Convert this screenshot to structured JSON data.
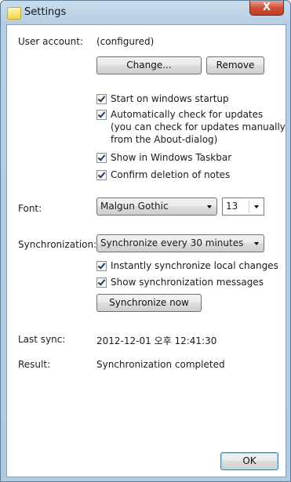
{
  "window": {
    "title": "Settings",
    "close_label": "X"
  },
  "user_account": {
    "label": "User account:",
    "value": "(configured)",
    "change_button": "Change...",
    "remove_button": "Remove"
  },
  "options": [
    {
      "label": "Start on windows startup",
      "checked": true
    },
    {
      "label": "Automatically check for updates\n(you can check for updates manually\nfrom the About-dialog)",
      "checked": true
    },
    {
      "label": "Show in Windows Taskbar",
      "checked": true
    },
    {
      "label": "Confirm deletion of notes",
      "checked": true
    }
  ],
  "font": {
    "label": "Font:",
    "family": "Malgun Gothic",
    "size": "13"
  },
  "sync": {
    "label": "Synchronization:",
    "interval": "Synchronize every 30 minutes",
    "instant_label": "Instantly synchronize local changes",
    "messages_label": "Show synchronization messages",
    "sync_now_button": "Synchronize now"
  },
  "last_sync": {
    "label": "Last sync:",
    "value": "2012-12-01 오후 12:41:30"
  },
  "result": {
    "label": "Result:",
    "value": "Synchronization completed"
  },
  "ok_button": "OK"
}
